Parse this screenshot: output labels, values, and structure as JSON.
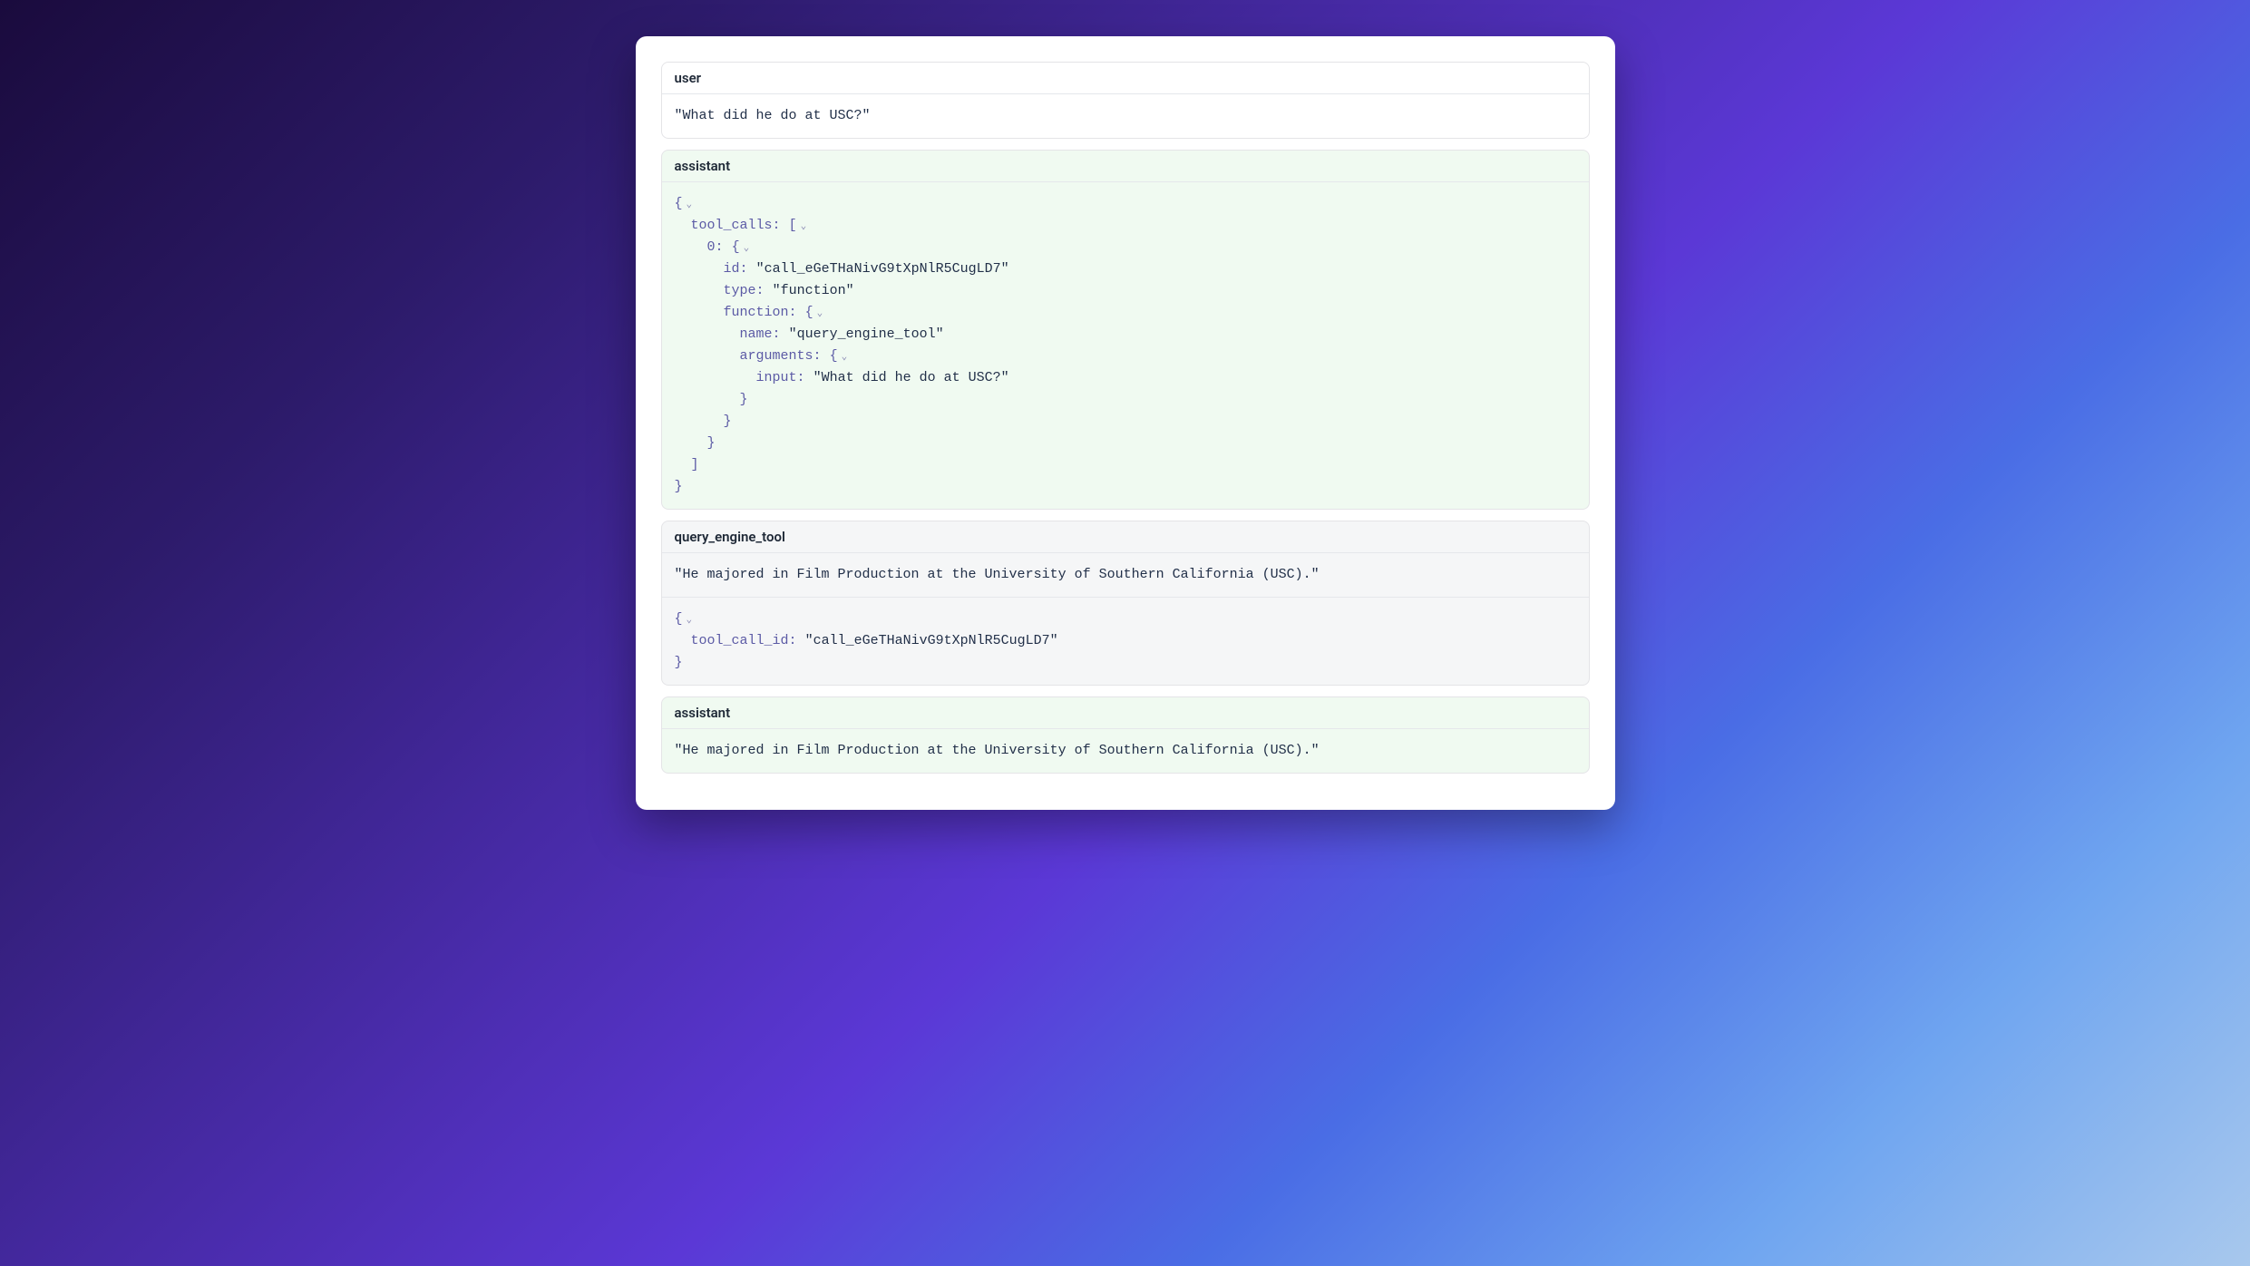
{
  "messages": {
    "user": {
      "role": "user",
      "content": "\"What did he do at USC?\""
    },
    "assistant1": {
      "role": "assistant",
      "tool_calls_label": "tool_calls",
      "index_label": "0",
      "id_key": "id",
      "id_value": "\"call_eGeTHaNivG9tXpNlR5CugLD7\"",
      "type_key": "type",
      "type_value": "\"function\"",
      "function_key": "function",
      "name_key": "name",
      "name_value": "\"query_engine_tool\"",
      "arguments_key": "arguments",
      "input_key": "input",
      "input_value": "\"What did he do at USC?\""
    },
    "tool": {
      "role": "query_engine_tool",
      "content": "\"He majored in Film Production at the University of Southern California (USC).\"",
      "tool_call_id_key": "tool_call_id",
      "tool_call_id_value": "\"call_eGeTHaNivG9tXpNlR5CugLD7\""
    },
    "assistant2": {
      "role": "assistant",
      "content": "\"He majored in Film Production at the University of Southern California (USC).\""
    }
  }
}
